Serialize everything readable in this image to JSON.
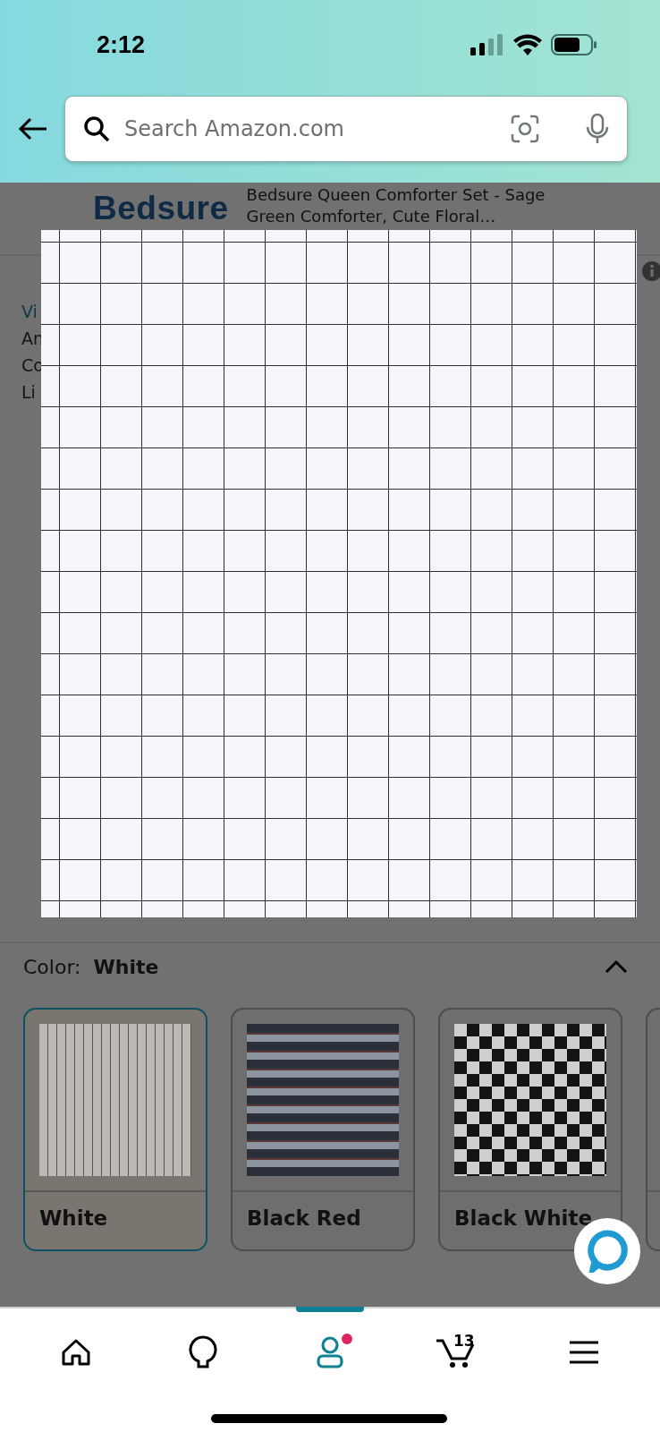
{
  "status_bar": {
    "time": "2:12"
  },
  "search": {
    "placeholder": "Search Amazon.com"
  },
  "product_header": {
    "brand_logo": "Bedsure",
    "title": "Bedsure Queen Comforter Set - Sage Green Comforter, Cute Floral…"
  },
  "description_fragments": [
    {
      "text": "Vi",
      "kind": "link"
    },
    {
      "text": "An",
      "kind": "text"
    },
    {
      "text": "Co",
      "kind": "text"
    },
    {
      "text": "Li",
      "kind": "text"
    }
  ],
  "color_selector": {
    "label": "Color:",
    "value": "White",
    "expanded": true,
    "options": [
      {
        "name": "White",
        "selected": true
      },
      {
        "name": "Black Red",
        "selected": false
      },
      {
        "name": "Black White",
        "selected": false
      },
      {
        "selected": false
      }
    ]
  },
  "bottom_nav": [
    {
      "kind": "home",
      "selected": false
    },
    {
      "kind": "ideas",
      "selected": false
    },
    {
      "kind": "account",
      "selected": true,
      "notification": true
    },
    {
      "kind": "cart",
      "selected": false,
      "count": "13"
    },
    {
      "kind": "menu",
      "selected": false
    }
  ]
}
